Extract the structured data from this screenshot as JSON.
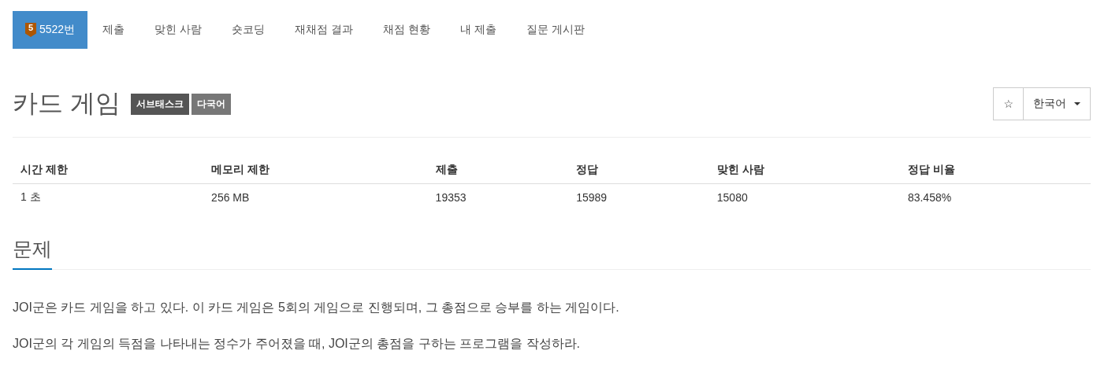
{
  "tabs": [
    {
      "label": "5522번",
      "tier": "5",
      "selected": true
    },
    {
      "label": "제출",
      "selected": false
    },
    {
      "label": "맞힌 사람",
      "selected": false
    },
    {
      "label": "숏코딩",
      "selected": false
    },
    {
      "label": "재채점 결과",
      "selected": false
    },
    {
      "label": "채점 현황",
      "selected": false
    },
    {
      "label": "내 제출",
      "selected": false
    },
    {
      "label": "질문 게시판",
      "selected": false
    }
  ],
  "title": "카드 게임",
  "tags": [
    {
      "label": "서브태스크",
      "color": "#555555"
    },
    {
      "label": "다국어",
      "color": "#777777"
    }
  ],
  "star_button": "☆",
  "language": "한국어",
  "table": {
    "columns": [
      "시간 제한",
      "메모리 제한",
      "제출",
      "정답",
      "맞힌 사람",
      "정답 비율"
    ],
    "rows": [
      [
        "1 초",
        "256 MB",
        "19353",
        "15989",
        "15080",
        "83.458%"
      ]
    ]
  },
  "section": {
    "heading": "문제",
    "paragraphs": [
      "JOI군은 카드 게임을 하고 있다. 이 카드 게임은 5회의 게임으로 진행되며, 그 총점으로 승부를 하는 게임이다.",
      "JOI군의 각 게임의 득점을 나타내는 정수가 주어졌을 때, JOI군의 총점을 구하는 프로그램을 작성하라."
    ]
  }
}
